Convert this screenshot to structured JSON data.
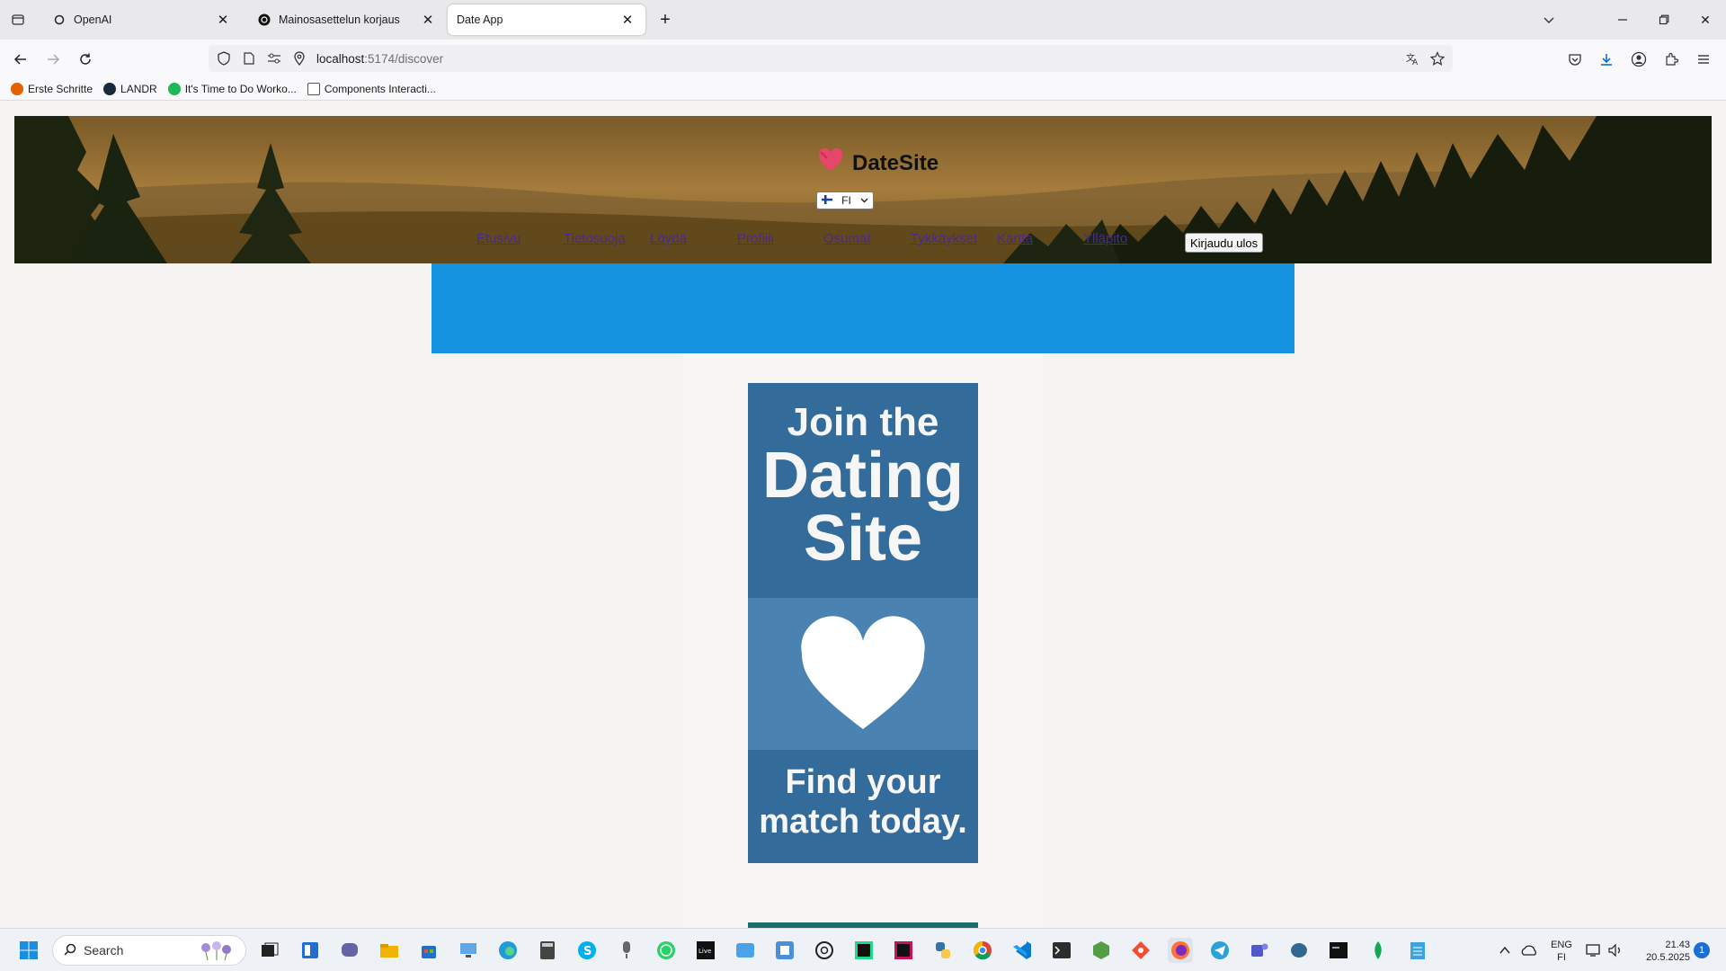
{
  "browser": {
    "tabs": [
      {
        "title": "OpenAI",
        "active": false
      },
      {
        "title": "Mainosasettelun korjaus",
        "active": false
      },
      {
        "title": "Date App",
        "active": true
      }
    ],
    "url_host": "localhost",
    "url_path": ":5174/discover",
    "bookmarks": [
      {
        "label": "Erste Schritte",
        "color": "#e66000"
      },
      {
        "label": "LANDR",
        "color": "#1b2a3a"
      },
      {
        "label": "It's Time to Do Worko...",
        "color": "#1db954"
      },
      {
        "label": "Components Interacti...",
        "color": "#555555"
      }
    ]
  },
  "site": {
    "brand": "DateSite",
    "language": "FI",
    "nav": [
      "Etusivu",
      "Tietosuoja",
      "Löydä",
      "Profiili",
      "Osumat",
      "Tykkäykset",
      "Kartta",
      "Ylläpito"
    ],
    "logout_label": "Kirjaudu ulos"
  },
  "ad": {
    "line1": "Join the",
    "line2": "Dating",
    "line3": "Site",
    "footer1": "Find your",
    "footer2": "match today."
  },
  "taskbar": {
    "search_placeholder": "Search",
    "lang_top": "ENG",
    "lang_bottom": "FI",
    "time": "21.43",
    "date": "20.5.2025",
    "notification_count": "1"
  },
  "colors": {
    "accent_blue": "#1592e0",
    "ad_dark": "#336b9b",
    "ad_mid": "#4a82b1"
  }
}
